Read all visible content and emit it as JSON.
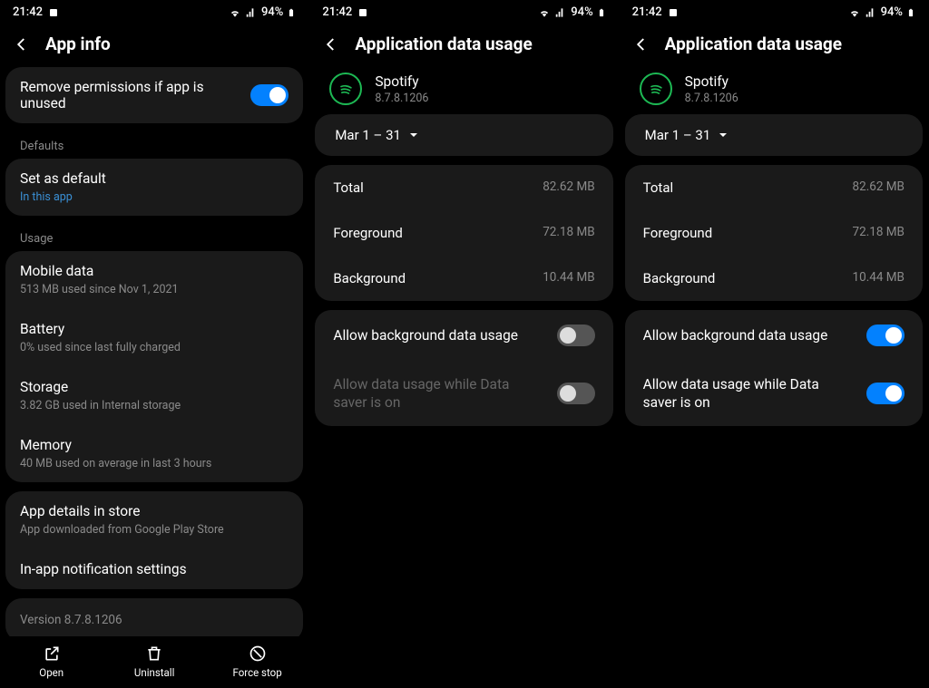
{
  "status": {
    "time": "21:42",
    "battery": "94%"
  },
  "panel1": {
    "title": "App info",
    "remove_perms": "Remove permissions if app is unused",
    "defaults_label": "Defaults",
    "set_default": "Set as default",
    "set_default_sub": "In this app",
    "usage_label": "Usage",
    "mobile_data": "Mobile data",
    "mobile_data_sub": "513 MB used since Nov 1, 2021",
    "battery": "Battery",
    "battery_sub": "0% used since last fully charged",
    "storage": "Storage",
    "storage_sub": "3.82 GB used in Internal storage",
    "memory": "Memory",
    "memory_sub": "40 MB used on average in last 3 hours",
    "app_details": "App details in store",
    "app_details_sub": "App downloaded from Google Play Store",
    "inapp_notif": "In-app notification settings",
    "version": "Version 8.7.8.1206",
    "open": "Open",
    "uninstall": "Uninstall",
    "force_stop": "Force stop"
  },
  "panel2": {
    "title": "Application data usage",
    "app_name": "Spotify",
    "app_version": "8.7.8.1206",
    "date_range": "Mar 1 – 31",
    "total": "Total",
    "total_val": "82.62 MB",
    "foreground": "Foreground",
    "foreground_val": "72.18 MB",
    "background": "Background",
    "background_val": "10.44 MB",
    "allow_bg": "Allow background data usage",
    "allow_saver": "Allow data usage while Data saver is on"
  },
  "panel3": {
    "title": "Application data usage",
    "app_name": "Spotify",
    "app_version": "8.7.8.1206",
    "date_range": "Mar 1 – 31",
    "total": "Total",
    "total_val": "82.62 MB",
    "foreground": "Foreground",
    "foreground_val": "72.18 MB",
    "background": "Background",
    "background_val": "10.44 MB",
    "allow_bg": "Allow background data usage",
    "allow_saver": "Allow data usage while Data saver is on"
  }
}
